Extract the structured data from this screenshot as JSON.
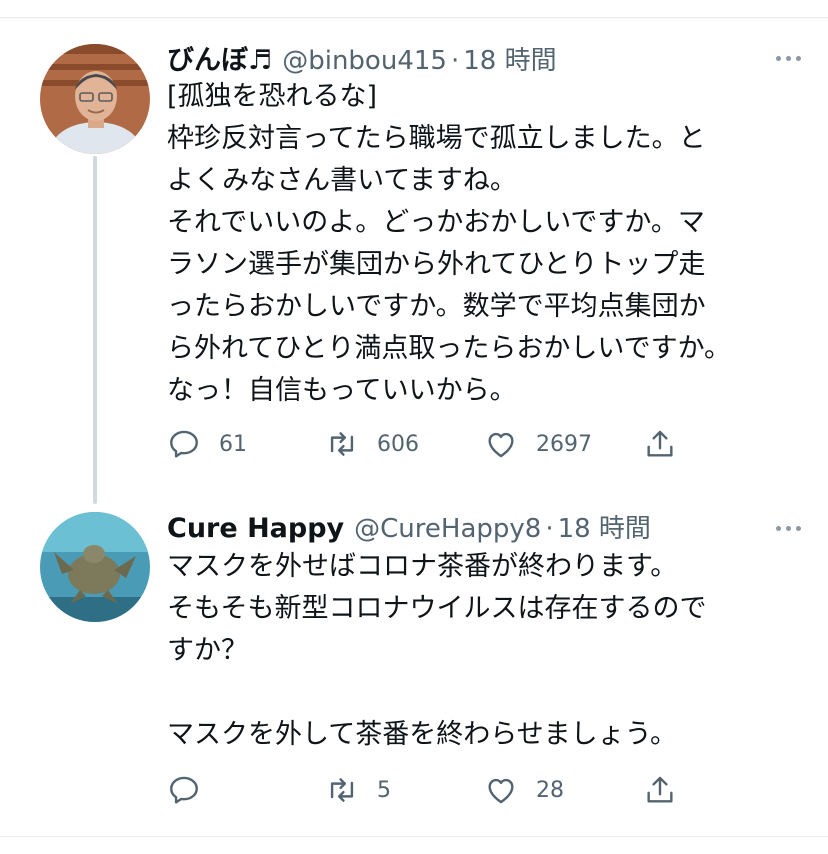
{
  "tweets": [
    {
      "name": "びんぼ♬",
      "handle": "@binbou415",
      "separator": "·",
      "time": "18 時間",
      "body_lines": [
        "[孤独を恐れるな]",
        "枠珍反対言ってたら職場で孤立しました。と",
        "よくみなさん書いてますね。",
        "それでいいのよ。どっかおかしいですか。マ",
        "ラソン選手が集団から外れてひとりトップ走",
        "ったらおかしいですか。数学で平均点集団か",
        "ら外れてひとり満点取ったらおかしいですか。",
        "なっ！自信もっていいから。"
      ],
      "actions": {
        "reply_icon": "reply-icon",
        "reply_count": "61",
        "retweet_icon": "retweet-icon",
        "retweet_count": "606",
        "like_icon": "heart-icon",
        "like_count": "2697",
        "share_icon": "share-icon"
      }
    },
    {
      "name": "Cure Happy",
      "handle": "@CureHappy8",
      "separator": "·",
      "time": "18 時間",
      "body_lines": [
        "マスクを外せばコロナ茶番が終わります。",
        "そもそも新型コロナウイルスは存在するので",
        "すか？",
        "",
        "マスクを外して茶番を終わらせましょう。"
      ],
      "actions": {
        "reply_icon": "reply-icon",
        "reply_count": "",
        "retweet_icon": "retweet-icon",
        "retweet_count": "5",
        "like_icon": "heart-icon",
        "like_count": "28",
        "share_icon": "share-icon"
      }
    }
  ],
  "colors": {
    "text_primary": "#0f1419",
    "text_secondary": "#536471",
    "icon": "#536471",
    "divider": "#e6ecf0",
    "thread_line": "#cfd9de"
  }
}
